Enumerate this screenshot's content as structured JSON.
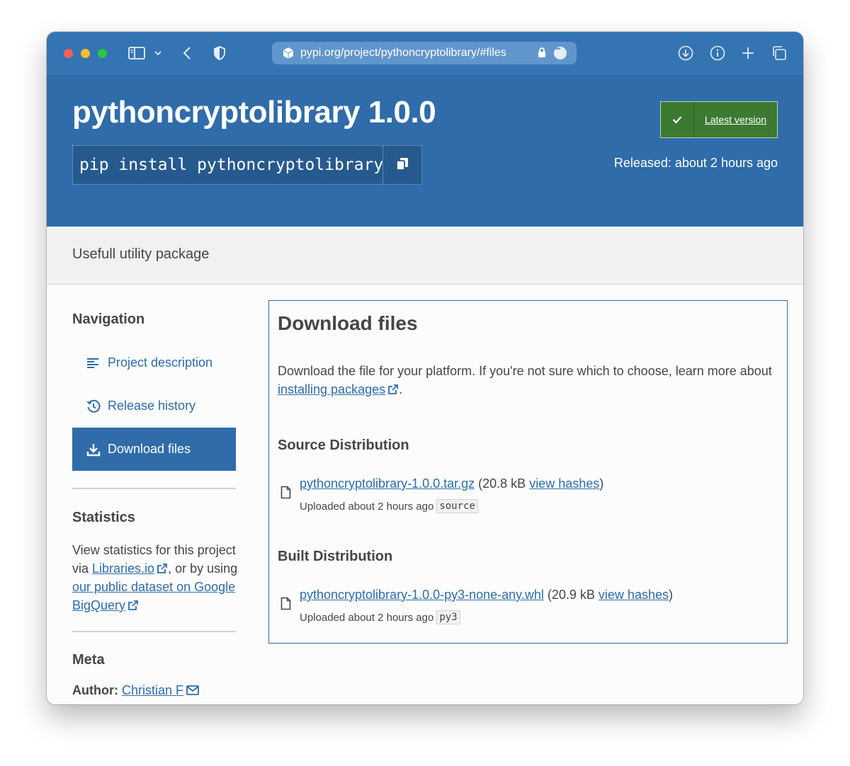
{
  "browser": {
    "url": "pypi.org/project/pythoncryptolibrary/#files",
    "icons": [
      "sidebar-icon",
      "chevron-down-icon",
      "back-icon",
      "shield-icon",
      "download-icon",
      "info-icon",
      "plus-icon",
      "tabs-icon"
    ]
  },
  "header": {
    "title": "pythoncryptolibrary 1.0.0",
    "pip_command": "pip install pythoncryptolibrary",
    "latest_label": "Latest version",
    "released": "Released: about 2 hours ago"
  },
  "summary": "Usefull utility package",
  "sidebar": {
    "nav_heading": "Navigation",
    "nav_items": [
      {
        "label": "Project description",
        "icon": "align-left-icon",
        "active": false
      },
      {
        "label": "Release history",
        "icon": "history-icon",
        "active": false
      },
      {
        "label": "Download files",
        "icon": "download-icon",
        "active": true
      }
    ],
    "stats_heading": "Statistics",
    "stats_text_1": "View statistics for this project via ",
    "stats_link_1": "Libraries.io",
    "stats_text_2": ", or by using ",
    "stats_link_2": "our public dataset on Google BigQuery",
    "meta_heading": "Meta",
    "author_label": "Author:",
    "author_name": "Christian F"
  },
  "main": {
    "heading": "Download files",
    "intro": "Download the file for your platform. If you're not sure which to choose, learn more about ",
    "intro_link": "installing packages",
    "intro_end": ".",
    "source_heading": "Source Distribution",
    "built_heading": "Built Distribution",
    "files": [
      {
        "name": "pythoncryptolibrary-1.0.0.tar.gz",
        "size": "(20.8 kB",
        "hashes": "view hashes",
        "close": ")",
        "uploaded": "Uploaded about 2 hours ago",
        "tag": "source"
      },
      {
        "name": "pythoncryptolibrary-1.0.0-py3-none-any.whl",
        "size": "(20.9 kB",
        "hashes": "view hashes",
        "close": ")",
        "uploaded": "Uploaded about 2 hours ago",
        "tag": "py3"
      }
    ]
  },
  "colors": {
    "header_blue": "#2f6ca9",
    "toolbar_blue": "#3474b3",
    "latest_green": "#3c7a31"
  }
}
